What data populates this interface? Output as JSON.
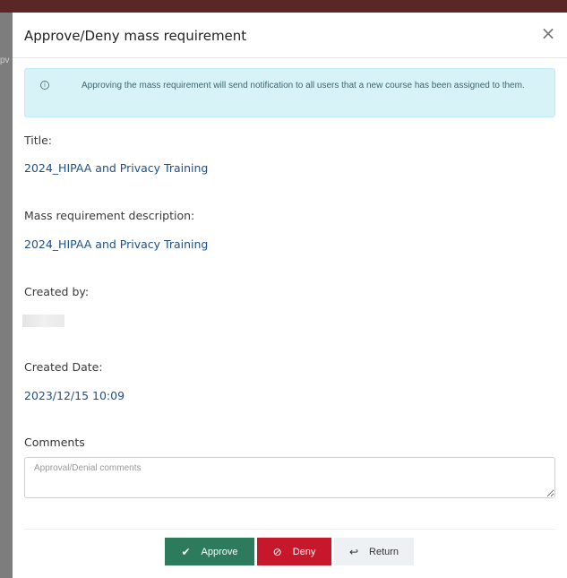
{
  "modal": {
    "title": "Approve/Deny mass requirement",
    "close_glyph": "×",
    "backdrop_stub": "pv"
  },
  "alert": {
    "icon": "ⓘ",
    "text": "Approving the mass requirement will send notification to all users that a new course has been assigned to them."
  },
  "fields": {
    "title_label": "Title:",
    "title_value": "2024_HIPAA and Privacy Training",
    "description_label": "Mass requirement description:",
    "description_value": "2024_HIPAA and Privacy Training",
    "created_by_label": "Created by:",
    "created_date_label": "Created Date:",
    "created_date_value": "2023/12/15 10:09"
  },
  "comments": {
    "label": "Comments",
    "placeholder": "Approval/Denial comments",
    "value": ""
  },
  "buttons": {
    "approve_label": "Approve",
    "approve_icon": "✔",
    "deny_label": "Deny",
    "deny_icon": "⊘",
    "return_label": "Return",
    "return_icon": "↩"
  },
  "colors": {
    "approve": "#2c7b5d",
    "deny": "#c7182b",
    "return": "#eef1f4",
    "info_bg": "#d8f3f8",
    "link_value": "#1f4f82"
  }
}
